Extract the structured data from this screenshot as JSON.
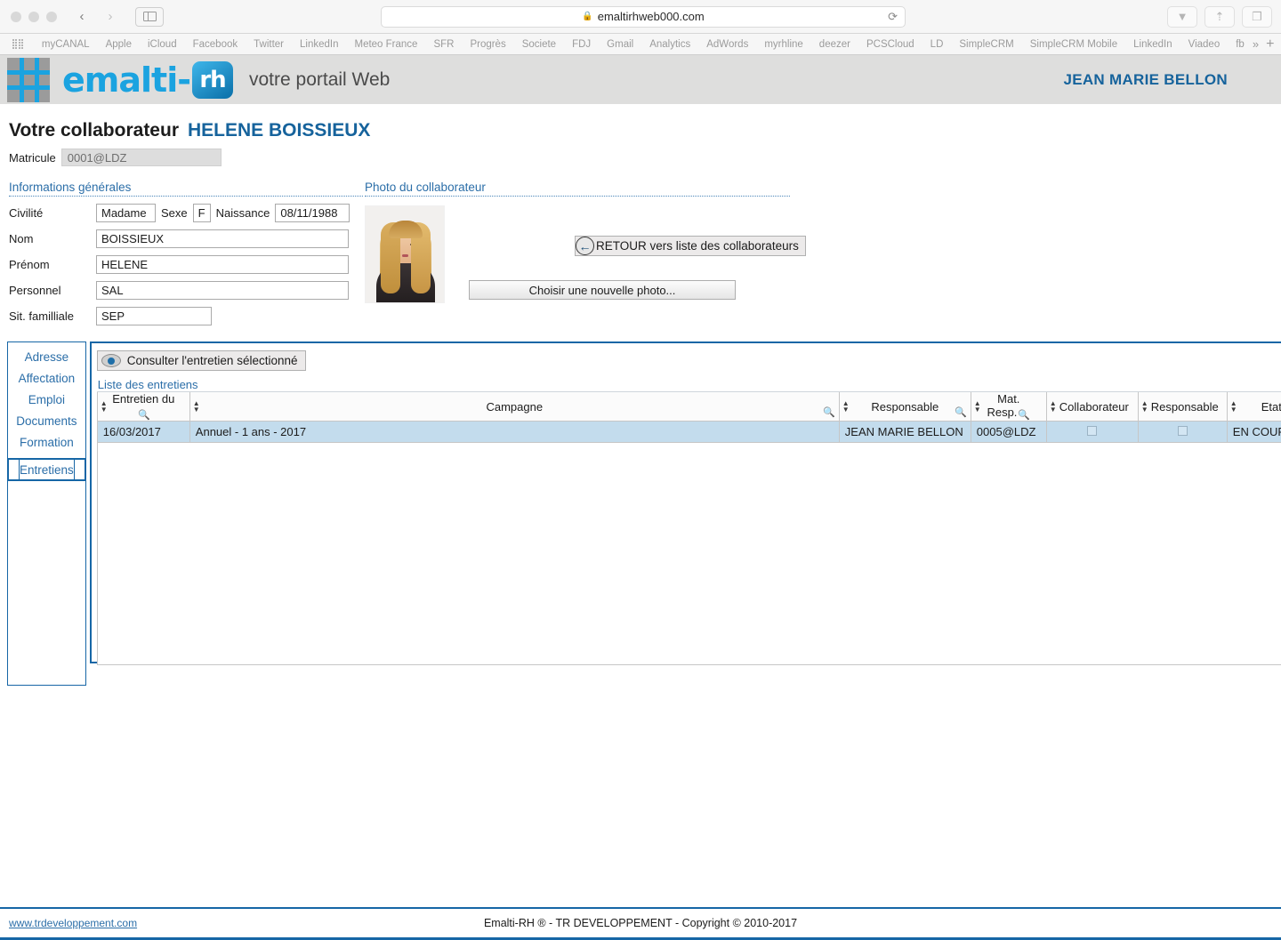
{
  "browser": {
    "url": "emaltirhweb000.com",
    "lock_icon": "lock-icon",
    "reload_icon": "reload-icon",
    "back_icon": "back-arrow-icon",
    "forward_icon": "forward-arrow-icon",
    "sidebar_icon": "sidebar-toggle-icon",
    "download_icon": "download-icon",
    "share_icon": "share-icon",
    "tabs_icon": "show-tabs-icon",
    "bookmarks": [
      "myCANAL",
      "Apple",
      "iCloud",
      "Facebook",
      "Twitter",
      "LinkedIn",
      "Meteo France",
      "SFR",
      "Progrès",
      "Societe",
      "FDJ",
      "Gmail",
      "Analytics",
      "AdWords",
      "myrhline",
      "deezer",
      "PCSCloud",
      "LD",
      "SimpleCRM",
      "SimpleCRM Mobile",
      "LinkedIn",
      "Viadeo",
      "fb"
    ],
    "bookmarks_overflow": "»",
    "bookmarks_add": "+"
  },
  "app": {
    "brand_word": "emalti-",
    "brand_chip": "rh",
    "tagline": "votre portail Web",
    "user": "JEAN MARIE BELLON",
    "accent_blue": "#1ba3e0",
    "link_blue": "#2b6ea8",
    "border_blue": "#1666a6"
  },
  "header": {
    "title_prefix": "Votre collaborateur",
    "collaborator_name": "HELENE BOISSIEUX",
    "back_button": "RETOUR vers liste des collaborateurs",
    "matricule_label": "Matricule",
    "matricule_value": "0001@LDZ"
  },
  "general_info": {
    "section_title": "Informations générales",
    "civilite_label": "Civilité",
    "civilite_value": "Madame",
    "sexe_label": "Sexe",
    "sexe_value": "F",
    "naissance_label": "Naissance",
    "naissance_value": "08/11/1988",
    "nom_label": "Nom",
    "nom_value": "BOISSIEUX",
    "prenom_label": "Prénom",
    "prenom_value": "HELENE",
    "personnel_label": "Personnel",
    "personnel_value": "SAL",
    "situation_label": "Sit. familliale",
    "situation_value": "SEP"
  },
  "photo": {
    "section_title": "Photo du collaborateur",
    "choose_button": "Choisir une nouvelle photo...",
    "alt": "collaborator-photo"
  },
  "tabs": {
    "items": [
      {
        "label": "Adresse",
        "active": false
      },
      {
        "label": "Affectation",
        "active": false
      },
      {
        "label": "Emploi",
        "active": false
      },
      {
        "label": "Documents",
        "active": false
      },
      {
        "label": "Formation",
        "active": false
      },
      {
        "label": "Entretiens",
        "active": true
      }
    ]
  },
  "panel": {
    "consult_button": "Consulter l'entretien sélectionné",
    "consult_icon": "eye-icon",
    "list_title": "Liste des entretiens",
    "columns": [
      "Entretien du",
      "Campagne",
      "Responsable",
      "Mat. Resp.",
      "Collaborateur",
      "Responsable",
      "Etat"
    ],
    "rows": [
      {
        "entretien_du": "16/03/2017",
        "campagne": "Annuel - 1 ans - 2017",
        "responsable": "JEAN MARIE BELLON",
        "mat_resp": "0005@LDZ",
        "collaborateur_checked": false,
        "responsable_checked": false,
        "etat": "EN COURS"
      }
    ]
  },
  "footer": {
    "link": "www.trdeveloppement.com",
    "copyright": "Emalti-RH ® - TR DEVELOPPEMENT - Copyright © 2010-2017"
  }
}
